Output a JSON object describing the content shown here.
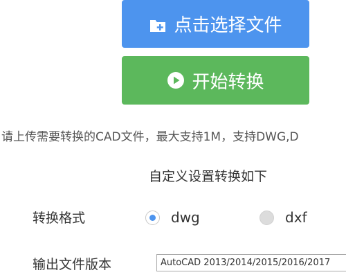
{
  "buttons": {
    "choose_file": {
      "label": "点击选择文件",
      "icon": "folder-add-icon",
      "color": "#4d94ee"
    },
    "start_convert": {
      "label": "开始转换",
      "icon": "play-circle-icon",
      "color": "#5cb85c"
    }
  },
  "hint": "请上传需要转换的CAD文件，最大支持1M，支持DWG,D",
  "settings": {
    "title": "自定义设置转换如下",
    "format": {
      "label": "转换格式",
      "options": [
        {
          "label": "dwg",
          "checked": true
        },
        {
          "label": "dxf",
          "checked": false
        }
      ]
    },
    "version": {
      "label": "输出文件版本",
      "selected": "AutoCAD 2013/2014/2015/2016/2017"
    }
  },
  "colors": {
    "accent": "#4d94ee",
    "success": "#5cb85c"
  }
}
